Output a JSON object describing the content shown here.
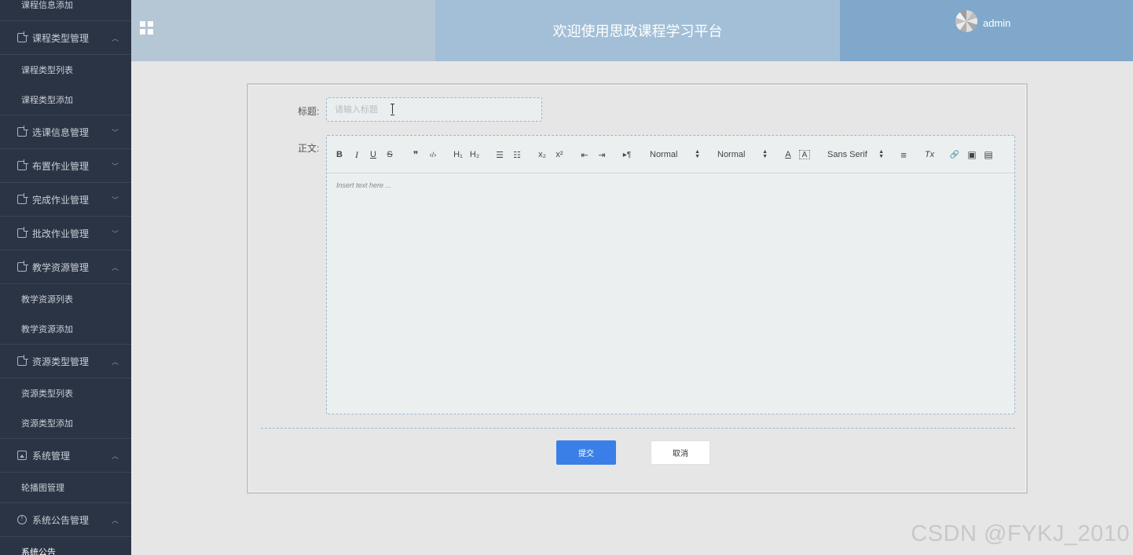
{
  "header": {
    "title": "欢迎使用思政课程学习平台",
    "username": "admin"
  },
  "sidebar": {
    "top_item": "课程信息添加",
    "groups": [
      {
        "label": "课程类型管理",
        "chevron": "^",
        "items": [
          "课程类型列表",
          "课程类型添加"
        ]
      },
      {
        "label": "选课信息管理",
        "chevron": "v",
        "items": []
      },
      {
        "label": "布置作业管理",
        "chevron": "v",
        "items": []
      },
      {
        "label": "完成作业管理",
        "chevron": "v",
        "items": []
      },
      {
        "label": "批改作业管理",
        "chevron": "v",
        "items": []
      },
      {
        "label": "教学资源管理",
        "chevron": "^",
        "items": [
          "教学资源列表",
          "教学资源添加"
        ]
      },
      {
        "label": "资源类型管理",
        "chevron": "^",
        "items": [
          "资源类型列表",
          "资源类型添加"
        ]
      },
      {
        "label": "系统管理",
        "chevron": "^",
        "items": [
          "轮播图管理"
        ]
      },
      {
        "label": "系统公告管理",
        "chevron": "^",
        "items": [
          "系统公告"
        ]
      }
    ]
  },
  "form": {
    "title_label": "标题:",
    "title_placeholder": "请输入标题",
    "title_value": "",
    "body_label": "正文:",
    "editor_placeholder": "Insert text here ...",
    "toolbar": {
      "bold": "B",
      "italic": "I",
      "underline": "U",
      "strike": "S",
      "quote": "❞",
      "code": "‹/›",
      "h1": "H₁",
      "h2": "H₂",
      "ordered_list": "☰",
      "bullet_list": "☷",
      "subscript": "x₂",
      "superscript": "x²",
      "outdent": "⇤",
      "indent": "⇥",
      "direction": "▸¶",
      "size_select": "Normal",
      "header_select": "Normal",
      "color": "A",
      "background": "A",
      "font_select": "Sans Serif",
      "align": "≡",
      "clean": "Tx",
      "link": "🔗",
      "image": "▣",
      "video": "▤"
    },
    "submit_label": "提交",
    "cancel_label": "取消"
  },
  "watermark": "CSDN @FYKJ_2010",
  "colors": {
    "sidebar_bg": "#2b3445",
    "header_left": "#b5c6d5",
    "header_mid": "#a3bfd7",
    "header_right": "#80a8ca",
    "primary": "#3a7fe8"
  }
}
